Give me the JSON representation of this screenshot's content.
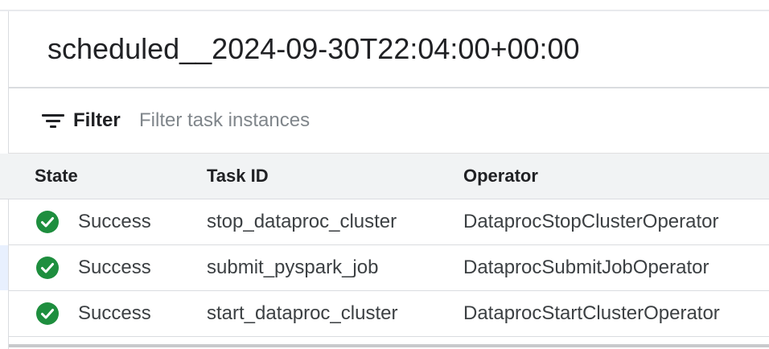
{
  "header": {
    "title": "scheduled__2024-09-30T22:04:00+00:00"
  },
  "filter": {
    "button_label": "Filter",
    "icon": "filter-list-icon",
    "placeholder": "Filter task instances",
    "value": ""
  },
  "table": {
    "columns": [
      "State",
      "Task ID",
      "Operator"
    ],
    "rows": [
      {
        "state": "Success",
        "state_icon": "check-circle-icon",
        "task_id": "stop_dataproc_cluster",
        "operator": "DataprocStopClusterOperator"
      },
      {
        "state": "Success",
        "state_icon": "check-circle-icon",
        "task_id": "submit_pyspark_job",
        "operator": "DataprocSubmitJobOperator"
      },
      {
        "state": "Success",
        "state_icon": "check-circle-icon",
        "task_id": "start_dataproc_cluster",
        "operator": "DataprocStartClusterOperator"
      }
    ]
  },
  "colors": {
    "success": "#1e8e3e",
    "header_bg": "#f1f3f4",
    "border": "#dadce0"
  }
}
